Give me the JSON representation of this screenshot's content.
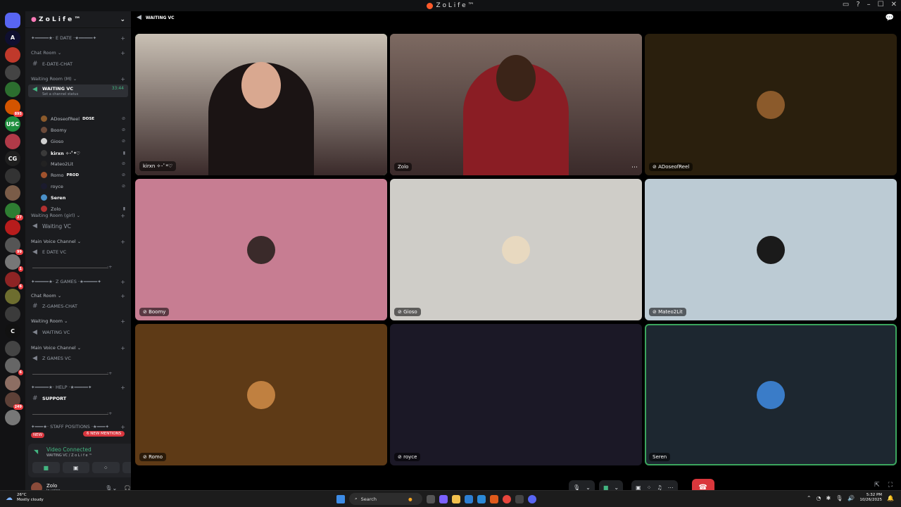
{
  "window": {
    "title": "Z o L i f e ™"
  },
  "server": {
    "name": "Z o L i f e ™"
  },
  "rail_servers": [
    {
      "label": "",
      "color": "#5865f2",
      "badge": ""
    },
    {
      "label": "A",
      "color": "#0f0f2f",
      "badge": ""
    },
    {
      "label": "",
      "color": "#c0392b",
      "badge": ""
    },
    {
      "label": "",
      "color": "#444444",
      "badge": ""
    },
    {
      "label": "",
      "color": "#2c6e2f",
      "badge": ""
    },
    {
      "label": "",
      "color": "#d35400",
      "badge": "895"
    },
    {
      "label": "USC",
      "color": "#1e8e3e",
      "badge": ""
    },
    {
      "label": "",
      "color": "#b03a48",
      "badge": ""
    },
    {
      "label": "CG",
      "color": "#1f1f1f",
      "badge": ""
    },
    {
      "label": "",
      "color": "#333333",
      "badge": ""
    },
    {
      "label": "",
      "color": "#7a5c48",
      "badge": ""
    },
    {
      "label": "",
      "color": "#2e7d32",
      "badge": "27"
    },
    {
      "label": "",
      "color": "#b71c1c",
      "badge": ""
    },
    {
      "label": "",
      "color": "#555555",
      "badge": "99"
    },
    {
      "label": "",
      "color": "#777777",
      "badge": "1"
    },
    {
      "label": "",
      "color": "#8e2424",
      "badge": "6"
    },
    {
      "label": "",
      "color": "#6d6d2f",
      "badge": ""
    },
    {
      "label": "",
      "color": "#3b3b3b",
      "badge": ""
    },
    {
      "label": "C",
      "color": "#111111",
      "badge": ""
    },
    {
      "label": "",
      "color": "#444444",
      "badge": ""
    },
    {
      "label": "",
      "color": "#666666",
      "badge": "6"
    },
    {
      "label": "",
      "color": "#8d6e63",
      "badge": ""
    },
    {
      "label": "",
      "color": "#5d4037",
      "badge": "249"
    },
    {
      "label": "",
      "color": "#777777",
      "badge": ""
    }
  ],
  "channels": {
    "edate_header": "✦━━━━━★· E DATE ·★━━━━━✦",
    "chat_room_1": "Chat Room",
    "edate_chat": "E-DATE-CHAT",
    "waiting_room_m": "Waiting Room (M)",
    "waiting_vc_active": "WAITING VC",
    "waiting_vc_time": "33:44",
    "waiting_vc_status": "Set a channel status",
    "users": [
      {
        "name": "ADoseofReel",
        "tag": "DOSE",
        "color": "#8b5a2b",
        "bold": false,
        "icon": "🎙"
      },
      {
        "name": "Boomy",
        "tag": "",
        "color": "#6b4a3a",
        "bold": false,
        "icon": "🎙"
      },
      {
        "name": "Gioso",
        "tag": "",
        "color": "#d0d0d0",
        "bold": false,
        "icon": "🎙"
      },
      {
        "name": "kirxn ✧･ﾟ*♡",
        "tag": "",
        "color": "#3a3a3a",
        "bold": true,
        "icon": "▣"
      },
      {
        "name": "Mateo2Lit",
        "tag": "",
        "color": "#222222",
        "bold": false,
        "icon": "🎙"
      },
      {
        "name": "Romo",
        "tag": "PROD",
        "color": "#a0522d",
        "bold": false,
        "icon": "🎙"
      },
      {
        "name": "royce",
        "tag": "",
        "color": "#1b1b2e",
        "bold": false,
        "icon": "🎙"
      },
      {
        "name": "Seren",
        "tag": "",
        "color": "#4a90c8",
        "bold": true,
        "icon": ""
      },
      {
        "name": "Zolo",
        "tag": "",
        "color": "#b03030",
        "bold": false,
        "icon": "▣"
      }
    ],
    "waiting_room_girl": "Waiting Room (girl)",
    "waiting_vc_2": "Waiting VC",
    "main_voice_1": "Main Voice Channel",
    "edate_vc": "E DATE VC",
    "zgames_header": "✦━━━━━★· Z GAMES ·★━━━━━✦",
    "chat_room_2": "Chat Room",
    "zgames_chat": "Z-GAMES-CHAT",
    "waiting_room_2": "Waiting Room",
    "waiting_vc_3": "WAITING VC",
    "main_voice_2": "Main Voice Channel",
    "zgames_vc": "Z GAMES VC",
    "help_header": "✦━━━━━★· HELP ·★━━━━━✦",
    "support": "SUPPORT",
    "staff_header": "✦━━━★· STAFF POSITIONS ·★━━━✦"
  },
  "mentions": {
    "new": "NEW",
    "count_label": "6 NEW MENTIONS"
  },
  "voice_panel": {
    "status": "Video Connected",
    "sub": "WAITING VC / Z o L i f e ™"
  },
  "user_panel": {
    "name": "Zolo",
    "status": "In voice"
  },
  "main": {
    "channel_title": "WAITING VC"
  },
  "tiles": [
    {
      "name": "kirxn ✧･ﾟ*♡",
      "bg": "#c9c0b4",
      "speaking": true,
      "video": true,
      "muted": false
    },
    {
      "name": "Zolo",
      "bg": "#7d6a62",
      "speaking": false,
      "video": true,
      "muted": false
    },
    {
      "name": "ADoseofReel",
      "bg": "#2a1f0d",
      "speaking": false,
      "video": false,
      "muted": true,
      "avatar": "#8b5a2b"
    },
    {
      "name": "Boomy",
      "bg": "#c77d92",
      "speaking": false,
      "video": false,
      "muted": true,
      "avatar": "#3a2a2a"
    },
    {
      "name": "Gioso",
      "bg": "#cfcdc8",
      "speaking": false,
      "video": false,
      "muted": true,
      "avatar": "#e8d9c0"
    },
    {
      "name": "Mateo2Lit",
      "bg": "#bccbd4",
      "speaking": false,
      "video": false,
      "muted": true,
      "avatar": "#1a1a1a"
    },
    {
      "name": "Romo",
      "bg": "#5e3a16",
      "speaking": false,
      "video": false,
      "muted": true,
      "avatar": "#c08040"
    },
    {
      "name": "royce",
      "bg": "#1b1826",
      "speaking": false,
      "video": false,
      "muted": true,
      "avatar": ""
    },
    {
      "name": "Seren",
      "bg": "#1d2730",
      "speaking": true,
      "video": false,
      "muted": false,
      "avatar": "#3a7cc8"
    }
  ],
  "taskbar": {
    "temp": "26°C",
    "weather": "Mostly cloudy",
    "search": "Search",
    "time": "5:32 PM",
    "date": "10/26/2025"
  }
}
